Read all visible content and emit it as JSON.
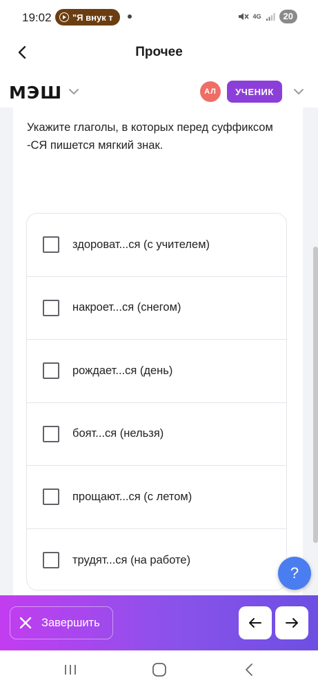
{
  "status_bar": {
    "time": "19:02",
    "media_label": "\"Я внук т",
    "network": "4G",
    "battery": "20"
  },
  "header": {
    "title": "Прочее"
  },
  "brand": {
    "logo": "МЭШ",
    "avatar_initials": "АЛ",
    "role": "УЧЕНИК",
    "colors": {
      "avatar": "#ee6e66",
      "role_badge": "#8c3fd8"
    }
  },
  "question": {
    "text": "Укажите глаголы, в которых перед суффиксом -СЯ пишется мягкий знак.",
    "options": [
      {
        "label": "здороват...ся (с учителем)",
        "checked": false
      },
      {
        "label": "накроет...ся (снегом)",
        "checked": false
      },
      {
        "label": "рождает...ся (день)",
        "checked": false
      },
      {
        "label": "боят...ся (нельзя)",
        "checked": false
      },
      {
        "label": "прощают...ся (с летом)",
        "checked": false
      },
      {
        "label": "трудят...ся (на работе)",
        "checked": false
      }
    ]
  },
  "help": {
    "label": "?"
  },
  "footer": {
    "finish_label": "Завершить",
    "gradient": [
      "#c23df0",
      "#6d4fe2"
    ]
  }
}
